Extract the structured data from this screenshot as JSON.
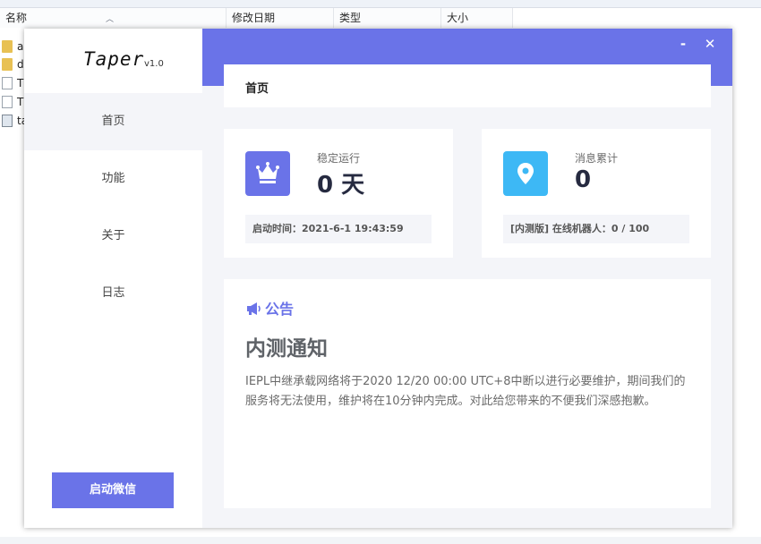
{
  "explorer": {
    "columns": [
      "名称",
      "修改日期",
      "类型",
      "大小"
    ],
    "files": [
      {
        "name": "a",
        "icon": "folder-icon"
      },
      {
        "name": "d",
        "icon": "folder-icon"
      },
      {
        "name": "T",
        "icon": "file-icon"
      },
      {
        "name": "T",
        "icon": "file-icon"
      },
      {
        "name": "ta",
        "icon": "exe-icon"
      }
    ]
  },
  "app": {
    "brand": {
      "name": "Taper",
      "version": "v1.0"
    },
    "nav": [
      "首页",
      "功能",
      "关于",
      "日志"
    ],
    "launch_button": "启动微信",
    "window_controls": {
      "minimize": "-",
      "close": "✕"
    },
    "page_title": "首页",
    "stats": [
      {
        "label": "稳定运行",
        "value": "0 天",
        "footer": "启动时间：2021-6-1 19:43:59",
        "icon": "crown-icon",
        "color": "#6a73e8"
      },
      {
        "label": "消息累计",
        "value": "0",
        "footer": "[内测版] 在线机器人：0 / 100",
        "icon": "location-pin-icon",
        "color": "#3db8f5"
      }
    ],
    "notice": {
      "heading": "公告",
      "title": "内测通知",
      "body": "IEPL中继承载网络将于2020 12/20 00:00 UTC+8中断以进行必要维护，期间我们的服务将无法使用，维护将在10分钟内完成。对此给您带来的不便我们深感抱歉。"
    },
    "accent_color": "#6a73e8"
  }
}
